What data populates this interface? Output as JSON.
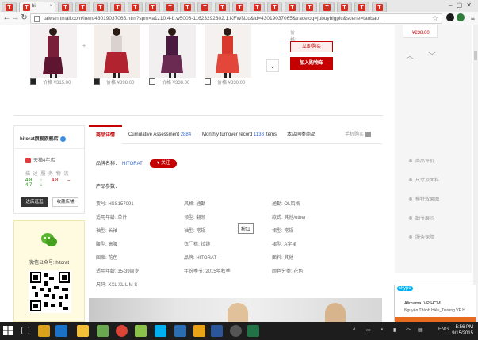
{
  "browser": {
    "active_tab_title": "hi",
    "tab_favicon_letter": "T",
    "url": "taiwan.tmall.com/item/43019037065.htm?spm=a1z10.4-b.w5003-11623292302.1.KFWNJd&id=43019037065&tracelog=jubuybigpic&scene=taobao_"
  },
  "product_bundle": {
    "items": [
      {
        "price": "价格 ¥315.00",
        "checked": true,
        "color": "#7a1f3a"
      },
      {
        "price": "价格 ¥398.00",
        "checked": true,
        "color": "#b0232f"
      },
      {
        "price": "价格 ¥330.00",
        "checked": false,
        "color": "#4a1a40"
      },
      {
        "price": "价格 ¥330.00",
        "checked": false,
        "color": "#d9382e"
      }
    ],
    "plus": "+",
    "old_price": "价格: ¥7?3.00",
    "select_label": "立即购买",
    "cart_label": "加入购物车",
    "chevron": "⌄"
  },
  "side_promo": {
    "price": "¥238.00",
    "links": [
      "商品评价",
      "尺寸及面料",
      "模特效果图",
      "细节展示",
      "服务保障"
    ]
  },
  "shop": {
    "name": "hitorat旗舰旗舰店",
    "years": "天猫4年店",
    "dsr_labels": "描 述   服 务   物 流",
    "dsr": [
      {
        "value": "4.8",
        "dir": "down"
      },
      {
        "value": "4.8",
        "dir": "up"
      },
      {
        "value": "4.7",
        "dir": "down"
      }
    ],
    "enter_label": "进店逛逛",
    "fav_label": "收藏店铺"
  },
  "wechat": {
    "title": "微信公众号: hitorat"
  },
  "detail_tabs": {
    "items": [
      {
        "label": "商品详情",
        "count": "",
        "active": true
      },
      {
        "label": "Cumulative Assessment ",
        "count": "2884",
        "active": false
      },
      {
        "label": "Monthly turnover record ",
        "count": "1138",
        "suffix": " items",
        "active": false
      },
      {
        "label": "本店同类商品",
        "count": "",
        "active": false
      }
    ],
    "mobile_label": "手机购买"
  },
  "brand": {
    "label": "品牌名称：",
    "name": "HITORAT",
    "follow_label": "♥ 关注"
  },
  "params": {
    "title": "产品参数：",
    "rows": [
      [
        "货号: HSS157091",
        "风格: 通勤",
        "通勤: OL风格"
      ],
      [
        "适用年龄: 单件",
        "领型: 翻领",
        "款式: 其他/other"
      ],
      [
        "袖型: 长袖",
        "袖型: 常规",
        "裙型: 常规"
      ],
      [
        "腰型: 高腰",
        "衣门襟: 拉链",
        "裙型: A字裙"
      ],
      [
        "图案: 花色",
        "品牌: HITORAT",
        "面料: 其他"
      ],
      [
        "适用年龄: 35-39周岁",
        "年份季节: 2015年秋季",
        "颜色分类: 花色"
      ],
      [
        "尺码: XXL XL L M S",
        "",
        ""
      ]
    ]
  },
  "tooltip": "粉红",
  "skype": {
    "logo": "skype",
    "name": "Alimama. VP HCM",
    "sub": "Nguyễn Thành Hiếu_Trường VP H..."
  },
  "taskbar": {
    "lang": "ENG",
    "time": "5:56 PM",
    "date": "9/15/2015"
  }
}
